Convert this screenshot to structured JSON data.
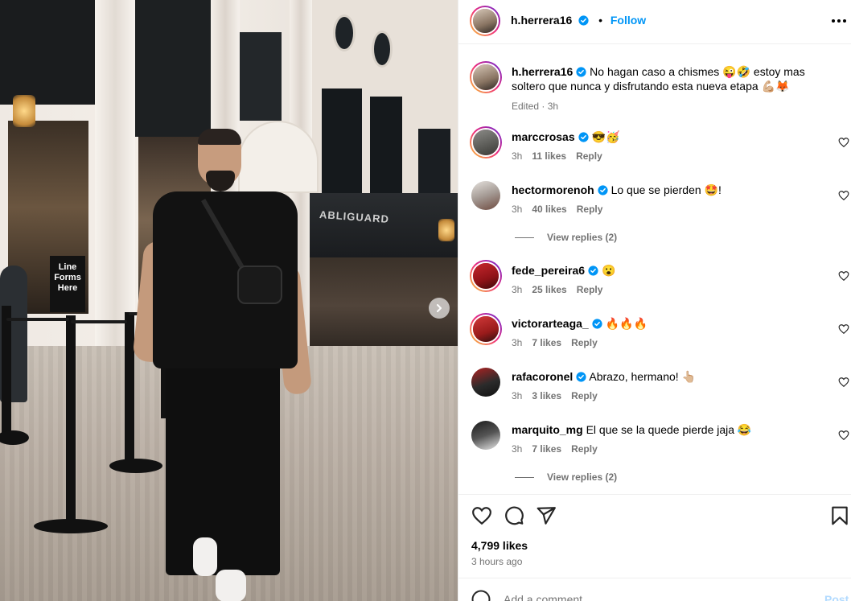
{
  "post": {
    "author": "h.herrera16",
    "follow_label": "Follow",
    "separator": "•",
    "caption": "No hagan caso a chismes 😜🤣 estoy mas soltero que nunca y disfrutando esta nueva etapa 💪🏼🦊",
    "caption_meta": "Edited · 3h",
    "photo_sign": "Line Forms Here",
    "storefront_sign": "ABLIGUARD"
  },
  "comments": [
    {
      "user": "marccrosas",
      "verified": true,
      "text": "😎🥳",
      "time": "3h",
      "likes": "11 likes",
      "reply": "Reply"
    },
    {
      "user": "hectormorenoh",
      "verified": true,
      "text": "Lo que se pierden 🤩!",
      "time": "3h",
      "likes": "40 likes",
      "reply": "Reply",
      "view_replies": "View replies (2)"
    },
    {
      "user": "fede_pereira6",
      "verified": true,
      "text": "😮",
      "time": "3h",
      "likes": "25 likes",
      "reply": "Reply"
    },
    {
      "user": "victorarteaga_",
      "verified": true,
      "text": "🔥🔥🔥",
      "time": "3h",
      "likes": "7 likes",
      "reply": "Reply"
    },
    {
      "user": "rafacoronel",
      "verified": true,
      "text": "Abrazo, hermano! 👆🏼",
      "time": "3h",
      "likes": "3 likes",
      "reply": "Reply"
    },
    {
      "user": "marquito_mg",
      "verified": false,
      "text": "El que se la quede pierde jaja 😂",
      "time": "3h",
      "likes": "7 likes",
      "reply": "Reply",
      "view_replies": "View replies (2)"
    }
  ],
  "footer": {
    "likes": "4,799 likes",
    "time": "3 hours ago",
    "add_comment_placeholder": "Add a comment...",
    "post_label": "Post"
  },
  "icons": {
    "verified": "verified-badge-icon",
    "heart": "heart-icon",
    "comment": "comment-icon",
    "share": "share-icon",
    "save": "bookmark-icon",
    "more": "more-icon",
    "next": "chevron-right-icon",
    "emoji": "smiley-icon"
  },
  "colors": {
    "accent": "#0095f6",
    "muted": "#737373",
    "border": "#efefef",
    "post_disabled": "#b3dbff"
  }
}
